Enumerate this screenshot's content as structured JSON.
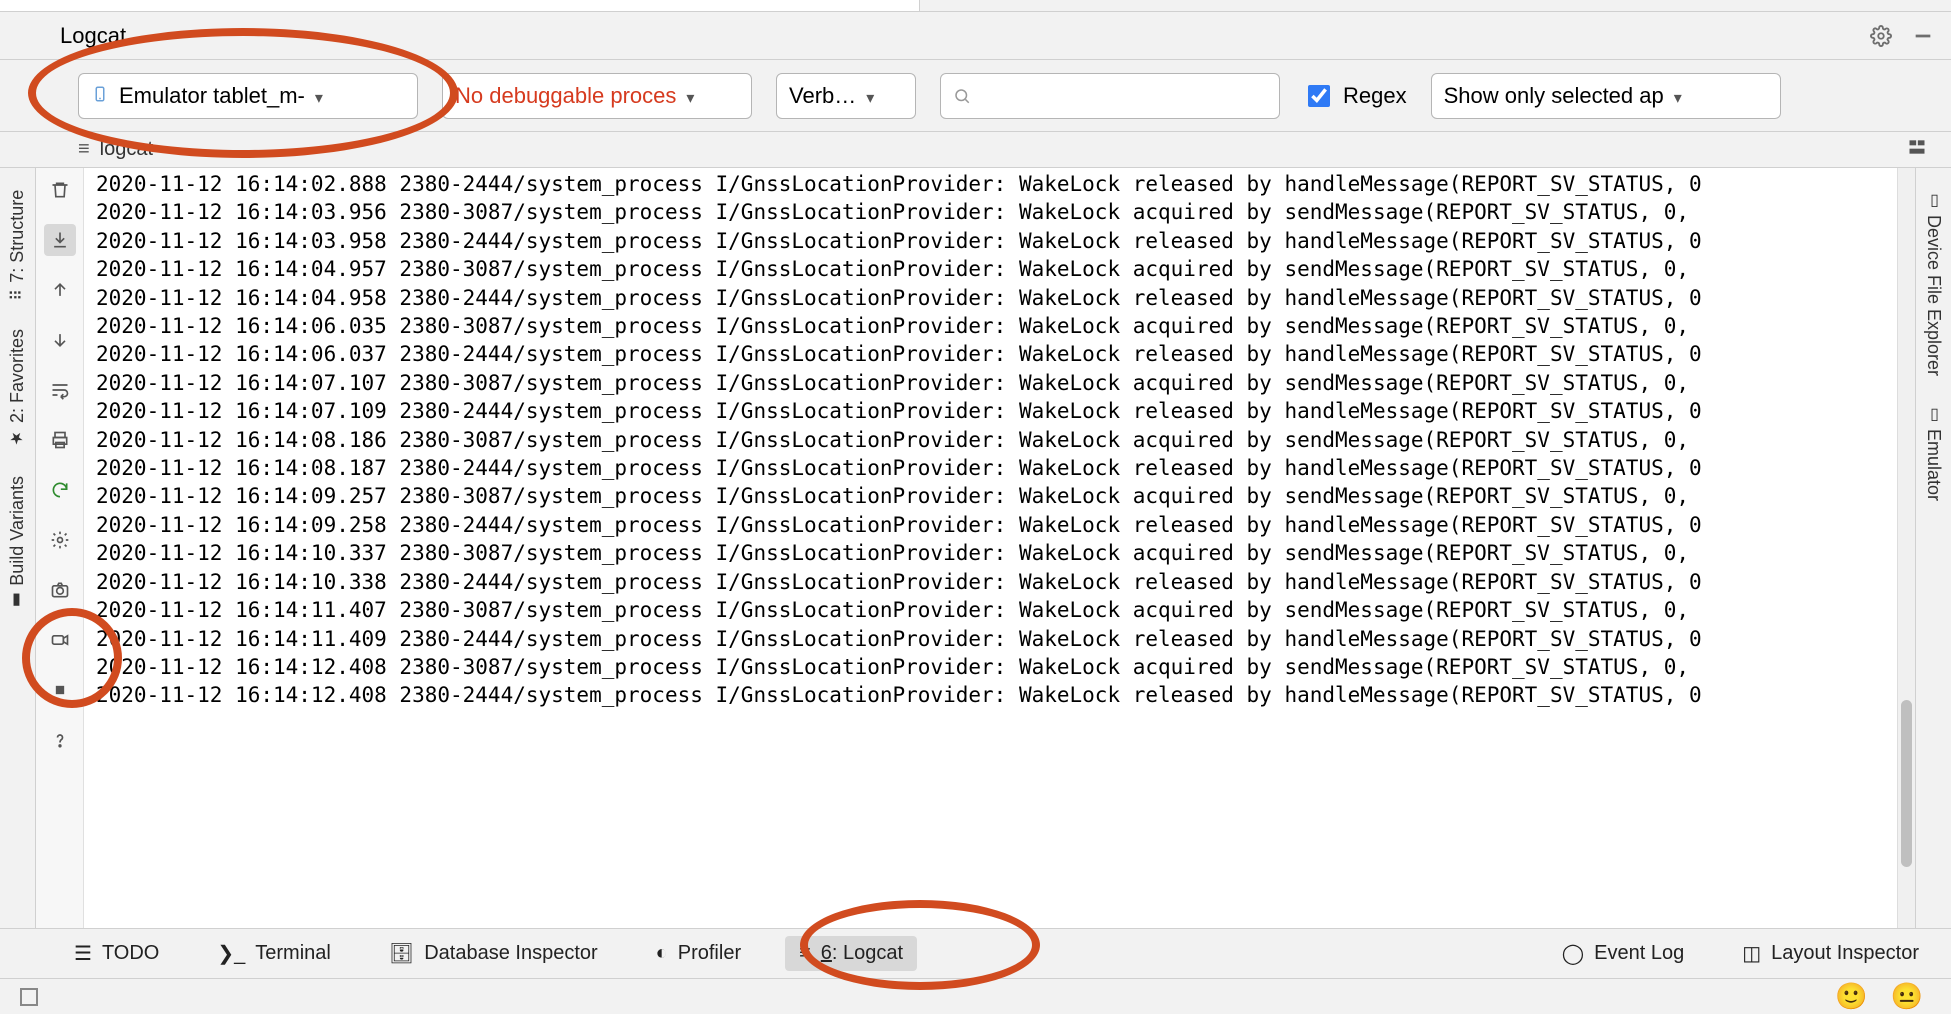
{
  "header": {
    "title": "Logcat"
  },
  "filters": {
    "device_label": "Emulator tablet_m-",
    "process_label": "No debuggable proces",
    "level_label": "Verb…",
    "search_placeholder": "",
    "regex_label": "Regex",
    "regex_checked": true,
    "scope_label": "Show only selected ap"
  },
  "subheader": {
    "label": "logcat"
  },
  "left_rail": [
    {
      "label": "7: Structure"
    },
    {
      "label": "2: Favorites"
    },
    {
      "label": "Build Variants"
    }
  ],
  "right_rail": [
    {
      "label": "Device File Explorer"
    },
    {
      "label": "Emulator"
    }
  ],
  "tool_column_icons": [
    "trash",
    "scroll-end",
    "arrow-up",
    "arrow-down",
    "wrap",
    "print",
    "restart",
    "gear",
    "camera",
    "video",
    "stop",
    "help"
  ],
  "log_lines": [
    "2020-11-12 16:14:02.888 2380-2444/system_process I/GnssLocationProvider: WakeLock released by handleMessage(REPORT_SV_STATUS, 0",
    "2020-11-12 16:14:03.956 2380-3087/system_process I/GnssLocationProvider: WakeLock acquired by sendMessage(REPORT_SV_STATUS, 0, ",
    "2020-11-12 16:14:03.958 2380-2444/system_process I/GnssLocationProvider: WakeLock released by handleMessage(REPORT_SV_STATUS, 0",
    "2020-11-12 16:14:04.957 2380-3087/system_process I/GnssLocationProvider: WakeLock acquired by sendMessage(REPORT_SV_STATUS, 0, ",
    "2020-11-12 16:14:04.958 2380-2444/system_process I/GnssLocationProvider: WakeLock released by handleMessage(REPORT_SV_STATUS, 0",
    "2020-11-12 16:14:06.035 2380-3087/system_process I/GnssLocationProvider: WakeLock acquired by sendMessage(REPORT_SV_STATUS, 0, ",
    "2020-11-12 16:14:06.037 2380-2444/system_process I/GnssLocationProvider: WakeLock released by handleMessage(REPORT_SV_STATUS, 0",
    "2020-11-12 16:14:07.107 2380-3087/system_process I/GnssLocationProvider: WakeLock acquired by sendMessage(REPORT_SV_STATUS, 0, ",
    "2020-11-12 16:14:07.109 2380-2444/system_process I/GnssLocationProvider: WakeLock released by handleMessage(REPORT_SV_STATUS, 0",
    "2020-11-12 16:14:08.186 2380-3087/system_process I/GnssLocationProvider: WakeLock acquired by sendMessage(REPORT_SV_STATUS, 0, ",
    "2020-11-12 16:14:08.187 2380-2444/system_process I/GnssLocationProvider: WakeLock released by handleMessage(REPORT_SV_STATUS, 0",
    "2020-11-12 16:14:09.257 2380-3087/system_process I/GnssLocationProvider: WakeLock acquired by sendMessage(REPORT_SV_STATUS, 0, ",
    "2020-11-12 16:14:09.258 2380-2444/system_process I/GnssLocationProvider: WakeLock released by handleMessage(REPORT_SV_STATUS, 0",
    "2020-11-12 16:14:10.337 2380-3087/system_process I/GnssLocationProvider: WakeLock acquired by sendMessage(REPORT_SV_STATUS, 0, ",
    "2020-11-12 16:14:10.338 2380-2444/system_process I/GnssLocationProvider: WakeLock released by handleMessage(REPORT_SV_STATUS, 0",
    "2020-11-12 16:14:11.407 2380-3087/system_process I/GnssLocationProvider: WakeLock acquired by sendMessage(REPORT_SV_STATUS, 0, ",
    "2020-11-12 16:14:11.409 2380-2444/system_process I/GnssLocationProvider: WakeLock released by handleMessage(REPORT_SV_STATUS, 0",
    "2020-11-12 16:14:12.408 2380-3087/system_process I/GnssLocationProvider: WakeLock acquired by sendMessage(REPORT_SV_STATUS, 0, ",
    "2020-11-12 16:14:12.408 2380-2444/system_process I/GnssLocationProvider: WakeLock released by handleMessage(REPORT_SV_STATUS, 0"
  ],
  "bottom": {
    "todo": "TODO",
    "terminal": "Terminal",
    "db": "Database Inspector",
    "profiler": "Profiler",
    "logcat_num": "6",
    "logcat_label": ": Logcat",
    "event_log": "Event Log",
    "layout_inspector": "Layout Inspector"
  }
}
